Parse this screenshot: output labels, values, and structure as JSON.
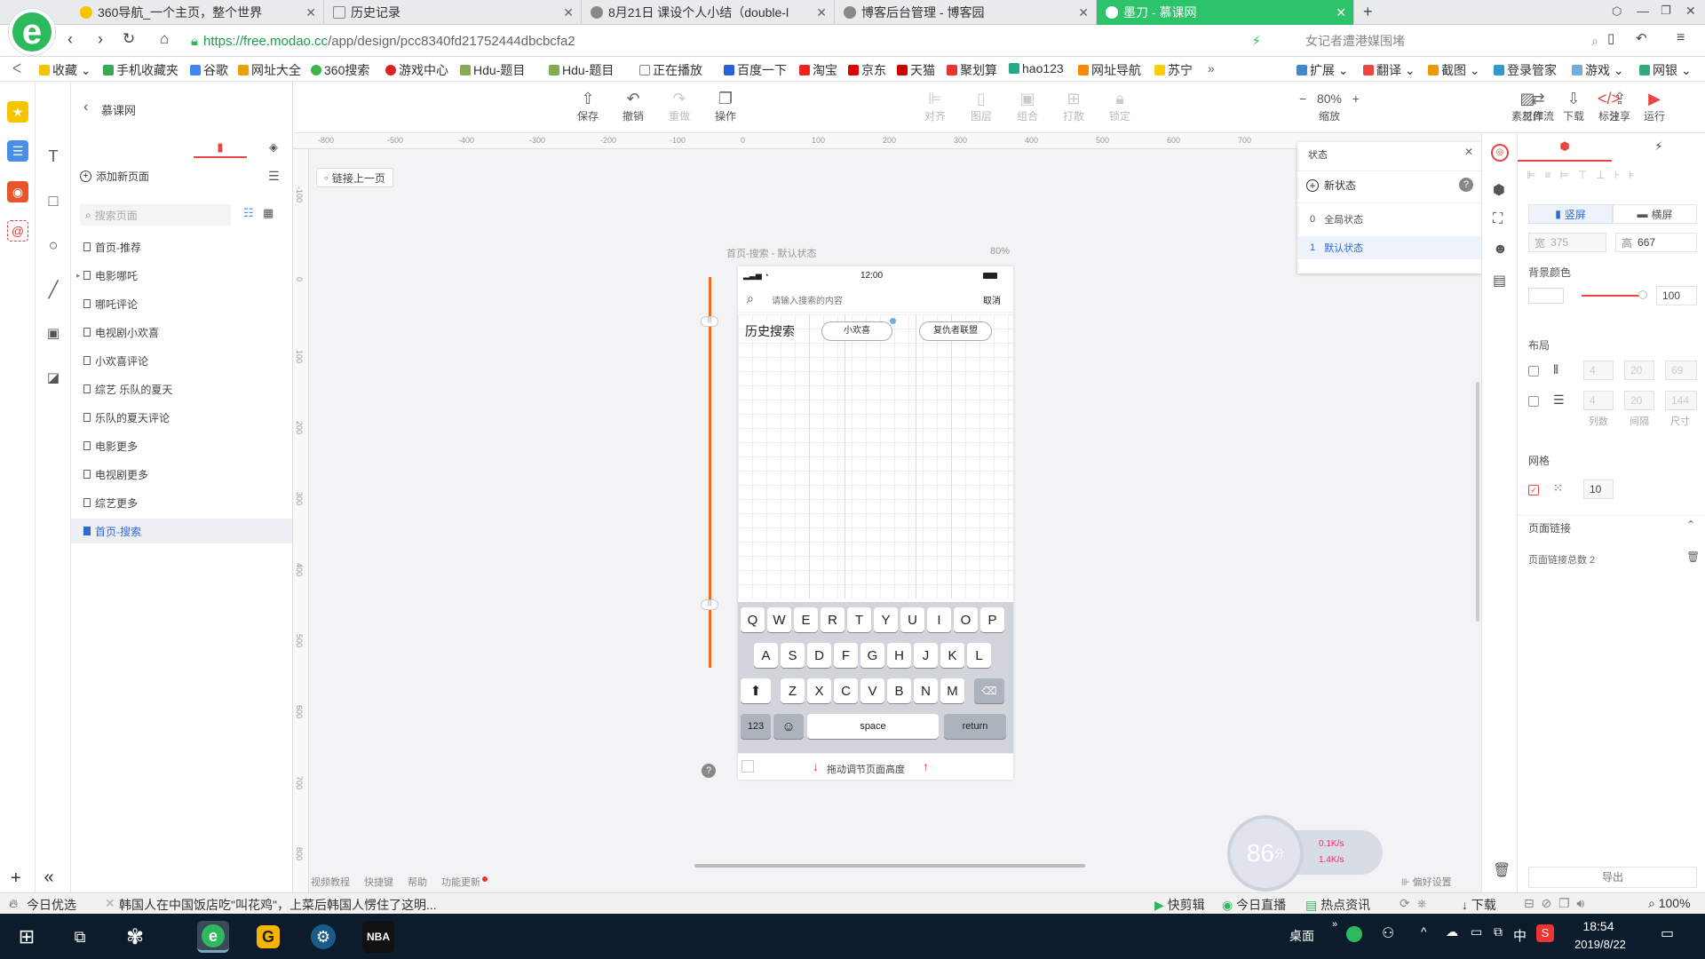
{
  "browser": {
    "tabs": [
      {
        "title": "360导航_一个主页，整个世界"
      },
      {
        "title": "历史记录"
      },
      {
        "title": "8月21日 课设个人小结（double-l"
      },
      {
        "title": "博客后台管理 - 博客园"
      },
      {
        "title": "墨刀 - 慕课网"
      }
    ],
    "new_tab": "+",
    "url_secure": "https://free.modao.cc",
    "url_rest": "/app/design/pcc8340fd21752444dbcbcfa2",
    "search_placeholder": "女记者遭港媒围堵",
    "bookmarks": [
      "收藏",
      "手机收藏夹",
      "谷歌",
      "网址大全",
      "360搜索",
      "游戏中心",
      "Hdu-题目",
      "Hdu-题目",
      "正在播放",
      "百度一下",
      "淘宝",
      "京东",
      "天猫",
      "聚划算",
      "hao123",
      "网址导航",
      "苏宁",
      "»"
    ],
    "bookmark_tools": [
      "扩展",
      "翻译",
      "截图",
      "登录管家",
      "游戏",
      "网银"
    ]
  },
  "app": {
    "project_name": "慕课网",
    "add_page_label": "添加新页面",
    "search_pages_placeholder": "搜索页面",
    "pages": [
      {
        "name": "首页-推荐"
      },
      {
        "name": "电影哪吒"
      },
      {
        "name": "哪吒评论"
      },
      {
        "name": "电视剧小欢喜"
      },
      {
        "name": "小欢喜评论"
      },
      {
        "name": "综艺 乐队的夏天"
      },
      {
        "name": "乐队的夏天评论"
      },
      {
        "name": "电影更多"
      },
      {
        "name": "电视剧更多"
      },
      {
        "name": "综艺更多"
      },
      {
        "name": "首页-搜索"
      }
    ],
    "toolbar": {
      "save": "保存",
      "undo": "撤销",
      "redo": "重做",
      "ops": "操作",
      "align": "对齐",
      "layers": "图层",
      "group": "组合",
      "ungroup": "打散",
      "lock": "锁定",
      "zoom": "80%",
      "zoom_label": "缩放",
      "assets": "素材库",
      "download": "下载",
      "share": "分享",
      "workflow": "工作流",
      "annotate": "标注",
      "run": "运行"
    },
    "link_prev_label": "链接上一页",
    "ruler_h": [
      "-800",
      "-500",
      "-400",
      "-300",
      "-200",
      "-100",
      "0",
      "100",
      "200",
      "300",
      "400",
      "500",
      "600",
      "700"
    ],
    "ruler_v": [
      "-100",
      "0",
      "100",
      "200",
      "300",
      "400",
      "500",
      "600",
      "700",
      "800"
    ],
    "canvas": {
      "frame_title": "首页-搜索 - 默认状态",
      "frame_zoom": "80%",
      "resize_hint": "拖动调节页面高度"
    },
    "phone": {
      "time": "12:00",
      "search_placeholder": "请输入搜索的内容",
      "cancel": "取消",
      "history_label": "历史搜索",
      "history_tags": [
        "小欢喜",
        "复仇者联盟"
      ],
      "kb_row1": [
        "Q",
        "W",
        "E",
        "R",
        "T",
        "Y",
        "U",
        "I",
        "O",
        "P"
      ],
      "kb_row2": [
        "A",
        "S",
        "D",
        "F",
        "G",
        "H",
        "J",
        "K",
        "L"
      ],
      "kb_row3": [
        "Z",
        "X",
        "C",
        "V",
        "B",
        "N",
        "M"
      ],
      "kb_123": "123",
      "kb_space": "space",
      "kb_return": "return"
    },
    "state_panel": {
      "title": "状态",
      "new_state": "新状态",
      "states": [
        {
          "index": "0",
          "name": "全局状态"
        },
        {
          "index": "1",
          "name": "默认状态"
        }
      ]
    },
    "props": {
      "portrait": "竖屏",
      "landscape": "横屏",
      "width": "375",
      "height_label": "高",
      "height": "667",
      "bg_label": "背景颜色",
      "opacity": "100",
      "layout_label": "布局",
      "layout_row1": [
        "4",
        "20",
        "69"
      ],
      "layout_row2": [
        "4",
        "20",
        "144"
      ],
      "layout_captions": [
        "列数",
        "间隔",
        "尺寸"
      ],
      "grid_label": "网格",
      "grid_value": "10",
      "page_links_label": "页面链接",
      "page_links_count": "页面链接总数  2",
      "export": "导出",
      "prefs": "偏好设置"
    },
    "footer_links": [
      "视频教程",
      "快捷键",
      "帮助",
      "功能更新"
    ],
    "speed_widget": {
      "score": "86",
      "unit": "分",
      "up": "0.1K/s",
      "down": "1.4K/s"
    }
  },
  "statusbar": {
    "left": "今日优选",
    "news": "韩国人在中国饭店吃\"叫花鸡\"，上菜后韩国人愣住了这明...",
    "right": [
      "快剪辑",
      "今日直播",
      "热点资讯",
      "下载",
      "100%"
    ]
  },
  "taskbar": {
    "desktop": "桌面",
    "ime": "中",
    "time": "18:54",
    "date": "2019/8/22"
  },
  "colors": {
    "accent_green": "#2dc36b",
    "selected_blue": "#2d6ad6",
    "handle_orange": "#f46b1f",
    "taskbar": "#0c1c2c"
  }
}
